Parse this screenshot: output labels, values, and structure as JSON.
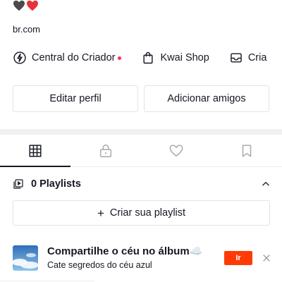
{
  "profile": {
    "bio_hearts": [
      "black-heart-icon",
      "red-heart-icon"
    ],
    "link": "br.com"
  },
  "shortcuts": [
    {
      "label": "Central do Criador",
      "icon": "lightning-circle-icon"
    },
    {
      "label": "Kwai Shop",
      "icon": "shopping-bag-icon"
    },
    {
      "label": "Cria",
      "icon": "inbox-icon"
    }
  ],
  "actions": {
    "edit_profile": "Editar perfil",
    "add_friends": "Adicionar amigos"
  },
  "tabs": [
    {
      "icon": "grid-icon",
      "active": true
    },
    {
      "icon": "lock-icon",
      "active": false
    },
    {
      "icon": "heart-outline-icon",
      "active": false
    },
    {
      "icon": "bookmark-icon",
      "active": false
    }
  ],
  "playlists": {
    "title": "0 Playlists",
    "create_label": "Criar sua playlist"
  },
  "promo": {
    "title": "Compartilhe o céu no álbum☁️",
    "subtitle": "Cate segredos do céu azul",
    "cta_label": "Ir"
  },
  "colors": {
    "text": "#161823",
    "accent": "#fe2c55",
    "cta": "#fe3b07",
    "border": "#e3e3e4",
    "band": "#f1f1f2"
  }
}
